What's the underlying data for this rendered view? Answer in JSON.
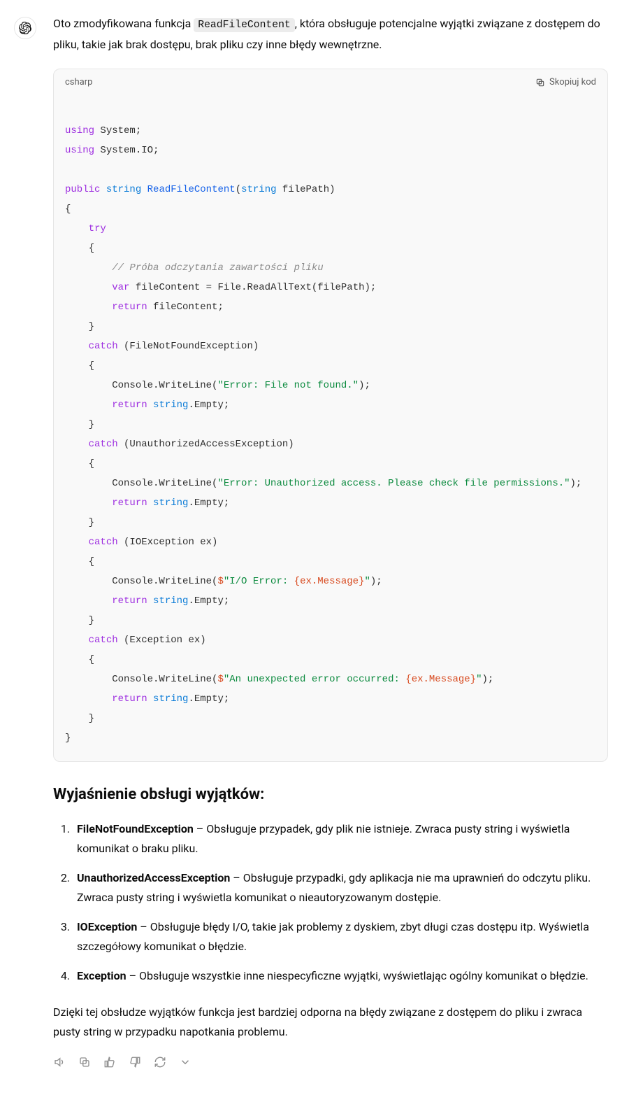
{
  "intro": {
    "before_code": "Oto zmodyfikowana funkcja ",
    "code": "ReadFileContent",
    "after_code": ", która obsługuje potencjalne wyjątki związane z dostępem do pliku, takie jak brak dostępu, brak pliku czy inne błędy wewnętrzne."
  },
  "code_block": {
    "lang": "csharp",
    "copy_label": "Skopiuj kod",
    "tokens": {
      "kw_using": "using",
      "ns_system": " System;",
      "ns_systemio": " System.IO;",
      "kw_public": "public",
      "kw_string": "string",
      "fn_name": "ReadFileContent",
      "paren_open": "(",
      "param_name": " filePath)",
      "brace_open": "{",
      "brace_close": "}",
      "kw_try": "try",
      "cmt_read": "// Próba odczytania zawartości pliku",
      "kw_var": "var",
      "line_filecontent": " fileContent = File.ReadAllText(filePath);",
      "kw_return": "return",
      "ret_filecontent": " fileContent;",
      "kw_catch": "catch",
      "catch_fnf": " (FileNotFoundException)",
      "cw_prefix": "        Console.WriteLine(",
      "str_fnf": "\"Error: File not found.\"",
      "cw_suffix": ");",
      "ret_empty_suffix": ".Empty;",
      "catch_ua": " (UnauthorizedAccessException)",
      "str_ua": "\"Error: Unauthorized access. Please check file permissions.\"",
      "catch_io": " (IOException ex)",
      "interp_dollar": "$",
      "str_io_a": "\"I/O Error: ",
      "interp_io": "{ex.Message}",
      "str_io_b": "\"",
      "catch_ex": " (Exception ex)",
      "str_ex_a": "\"An unexpected error occurred: ",
      "interp_ex": "{ex.Message}",
      "str_ex_b": "\""
    }
  },
  "explain_heading": "Wyjaśnienie obsługi wyjątków:",
  "items": [
    {
      "name": "FileNotFoundException",
      "desc": " – Obsługuje przypadek, gdy plik nie istnieje. Zwraca pusty string i wyświetla komunikat o braku pliku."
    },
    {
      "name": "UnauthorizedAccessException",
      "desc": " – Obsługuje przypadki, gdy aplikacja nie ma uprawnień do odczytu pliku. Zwraca pusty string i wyświetla komunikat o nieautoryzowanym dostępie."
    },
    {
      "name": "IOException",
      "desc": " – Obsługuje błędy I/O, takie jak problemy z dyskiem, zbyt długi czas dostępu itp. Wyświetla szczegółowy komunikat o błędzie."
    },
    {
      "name": "Exception",
      "desc": " – Obsługuje wszystkie inne niespecyficzne wyjątki, wyświetlając ogólny komunikat o błędzie."
    }
  ],
  "outro": "Dzięki tej obsłudze wyjątków funkcja jest bardziej odporna na błędy związane z dostępem do pliku i zwraca pusty string w przypadku napotkania problemu."
}
